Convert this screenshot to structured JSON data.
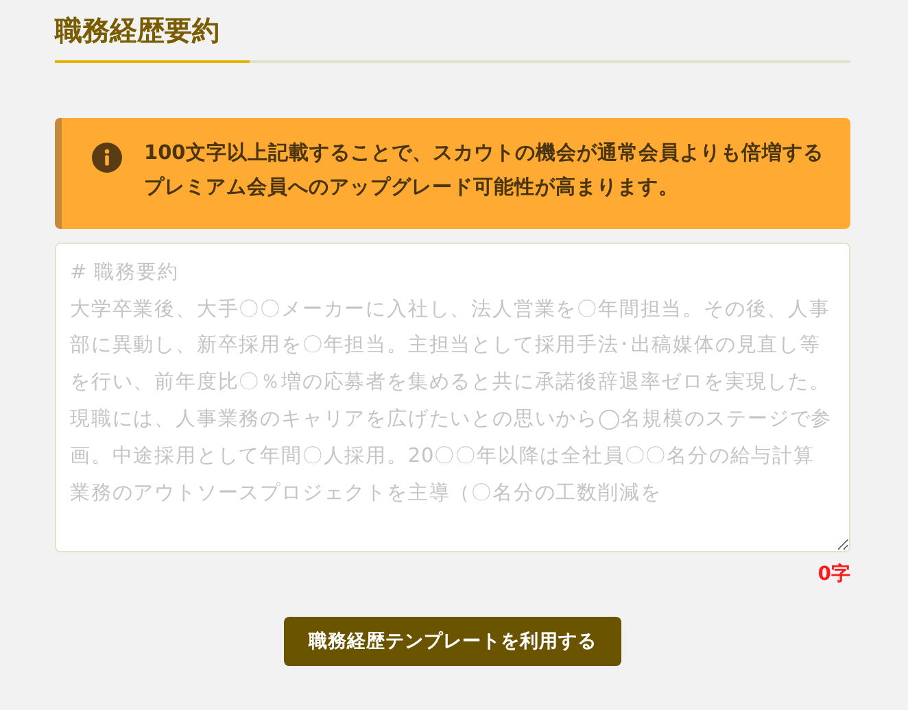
{
  "section": {
    "title": "職務経歴要約"
  },
  "notice": {
    "lines": [
      "100文字以上記載することで、スカウトの機会が通常会員よりも倍増する",
      "プレミアム会員へのアップグレード可能性が高まります。"
    ]
  },
  "summary_field": {
    "placeholder": [
      "# 職務要約",
      "大学卒業後、大手〇〇メーカーに入社し、法人営業を〇年間担当。その後、人事部に異動し、新卒採用を〇年担当。主担当として採用手法･出稿媒体の見直し等を行い、前年度比〇％増の応募者を集めると共に承諾後辞退率ゼロを実現した。",
      "現職には、人事業務のキャリアを広げたいとの思いから◯名規模のステージで参画。中途採用として年間〇人採用。20〇〇年以降は全社員〇〇名分の給与計算業務のアウトソースプロジェクトを主導（〇名分の工数削減を"
    ]
  },
  "char_count": "0字",
  "template_button": "職務経歴テンプレートを利用する"
}
